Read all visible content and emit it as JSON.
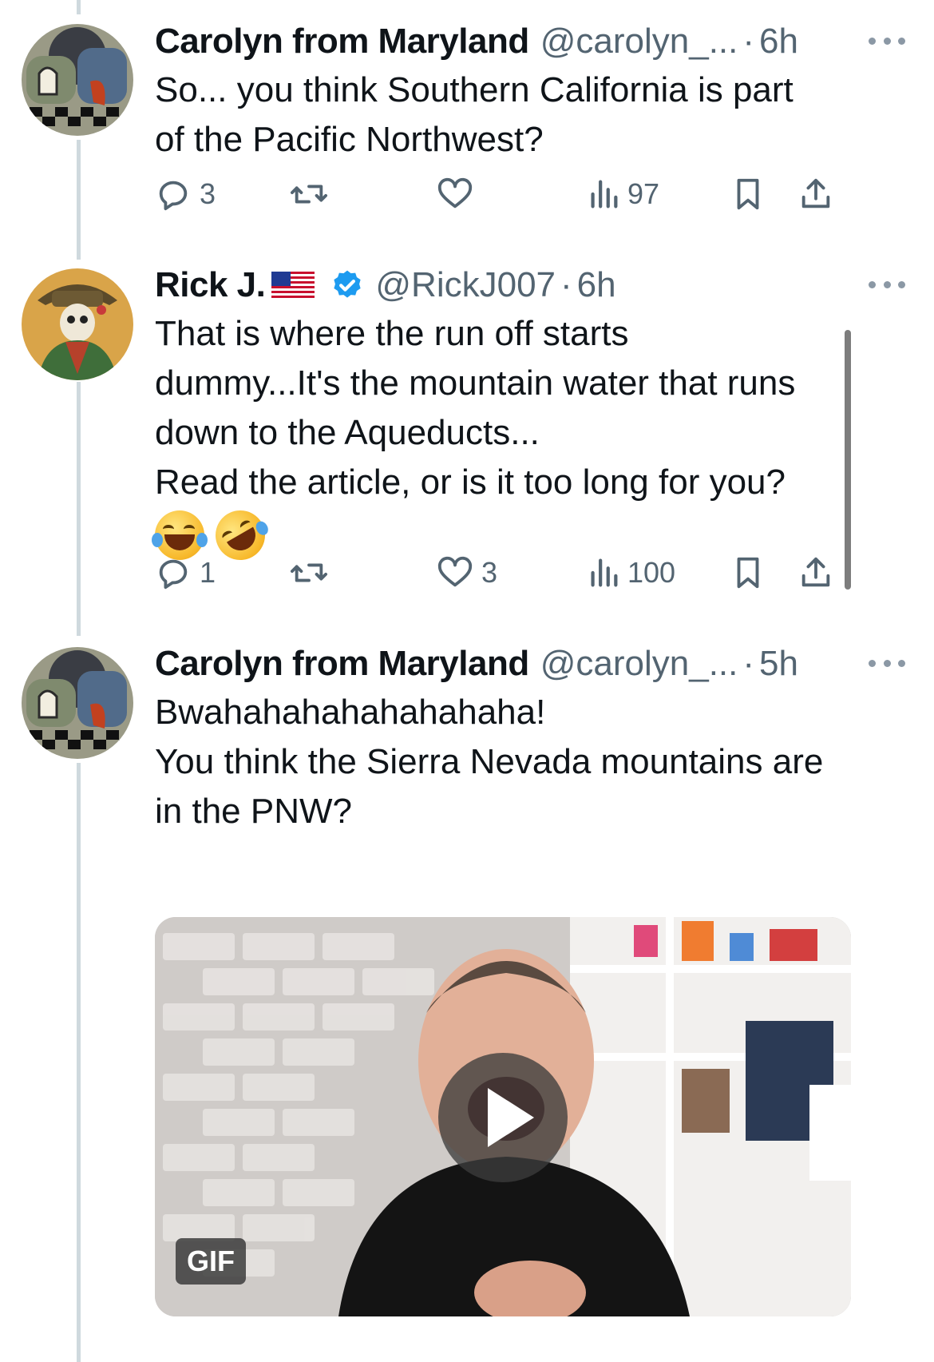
{
  "tweets": [
    {
      "name": "Carolyn from Maryland",
      "handle": "@carolyn_...",
      "separator": "·",
      "time": "6h",
      "lines": [
        "So... you think Southern California is part",
        "of the Pacific Northwest?"
      ],
      "replies": "3",
      "retweets": "",
      "likes": "",
      "views": "97"
    },
    {
      "name": "Rick J.",
      "handle": "@RickJ007",
      "separator": "·",
      "time": "6h",
      "flag": "us-flag",
      "verified": true,
      "lines": [
        "That is where the run off starts",
        "dummy...It's the mountain water that runs",
        "down to the Aqueducts...",
        "Read the article, or is it too long for you?"
      ],
      "emojis": [
        "face-with-tears-of-joy-icon",
        "rolling-on-the-floor-laughing-icon"
      ],
      "replies": "1",
      "retweets": "",
      "likes": "3",
      "views": "100"
    },
    {
      "name": "Carolyn from Maryland",
      "handle": "@carolyn_...",
      "separator": "·",
      "time": "5h",
      "lines": [
        "Bwahahahahahahahaha!",
        "You think the Sierra Nevada mountains are",
        "in the PNW?"
      ],
      "media": {
        "type": "gif",
        "badge": "GIF",
        "play_icon": "play-icon"
      }
    }
  ],
  "colors": {
    "text": "#0f1419",
    "muted": "#536471",
    "verified": "#1d9bf0",
    "thread_line": "#cfd9de"
  }
}
